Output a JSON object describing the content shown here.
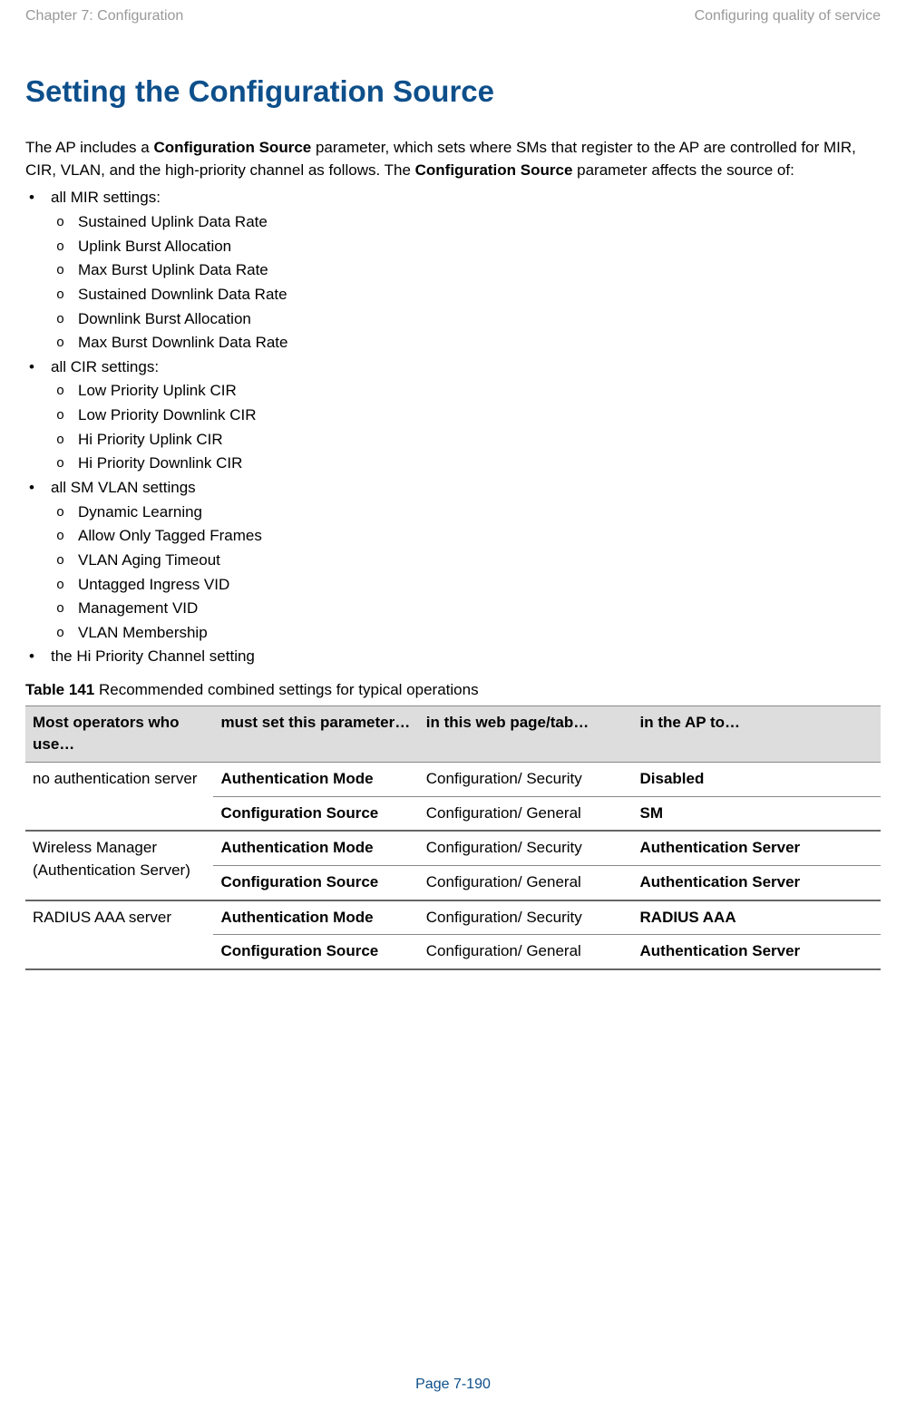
{
  "header": {
    "left": "Chapter 7:  Configuration",
    "right": "Configuring quality of service"
  },
  "title": "Setting the Configuration Source",
  "intro": {
    "p1a": "The AP includes a ",
    "p1b": "Configuration Source",
    "p1c": " parameter, which sets where SMs that register to the AP are controlled for MIR, CIR, VLAN, and the high-priority channel as follows. The ",
    "p1d": "Configuration Source",
    "p1e": " parameter affects the source of:"
  },
  "list": {
    "i0": "all MIR settings:",
    "i0s": [
      "Sustained Uplink Data Rate",
      "Uplink Burst Allocation",
      "Max Burst Uplink Data Rate",
      "Sustained Downlink Data Rate",
      "Downlink Burst Allocation",
      "Max Burst Downlink Data Rate"
    ],
    "i1": "all CIR settings:",
    "i1s": [
      "Low Priority Uplink CIR",
      "Low Priority Downlink CIR",
      "Hi Priority Uplink CIR",
      "Hi Priority Downlink CIR"
    ],
    "i2": "all SM VLAN settings",
    "i2s": [
      "Dynamic Learning",
      "Allow Only Tagged Frames",
      "VLAN Aging Timeout",
      "Untagged Ingress VID",
      "Management VID",
      "VLAN Membership"
    ],
    "i3": "the Hi Priority Channel setting"
  },
  "table_caption_prefix": "Table 141",
  "table_caption_rest": " Recommended combined settings for typical operations",
  "table": {
    "headers": [
      "Most operators who use…",
      "must set this parameter…",
      "in this web page/tab…",
      "in the AP to…"
    ],
    "rows": [
      {
        "label": "no authentication server",
        "r1": {
          "param": "Authentication Mode",
          "page": "Configuration/ Security",
          "val": "Disabled"
        },
        "r2": {
          "param": "Configuration Source",
          "page": "Configuration/ General",
          "val": "SM"
        }
      },
      {
        "label": "Wireless Manager (Authentication Server)",
        "r1": {
          "param": "Authentication Mode",
          "page": "Configuration/ Security",
          "val": "Authentication Server"
        },
        "r2": {
          "param": "Configuration Source",
          "page": "Configuration/ General",
          "val": "Authentication Server"
        }
      },
      {
        "label": "RADIUS AAA server",
        "r1": {
          "param": "Authentication Mode",
          "page": "Configuration/ Security",
          "val": "RADIUS AAA"
        },
        "r2": {
          "param": "Configuration Source",
          "page": "Configuration/ General",
          "val": "Authentication Server"
        }
      }
    ]
  },
  "footer": "Page 7-190"
}
